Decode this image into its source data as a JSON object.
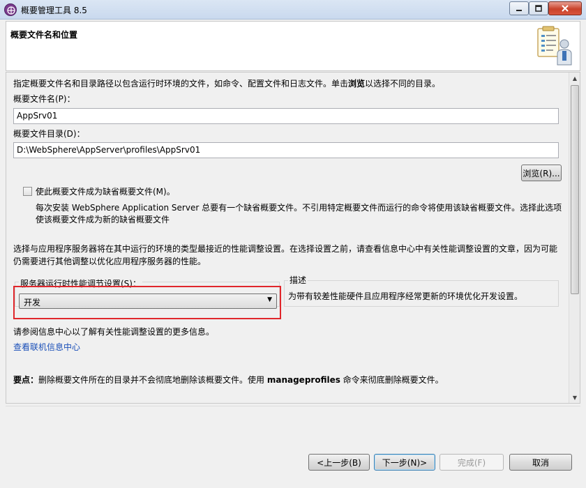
{
  "window": {
    "title": "概要管理工具 8.5",
    "minimize_glyph": "0",
    "maximize_glyph": "1",
    "close_glyph": "r"
  },
  "header": {
    "title": "概要文件名和位置",
    "icon": "clipboard-person-icon"
  },
  "intro_text": "指定概要文件名和目录路径以包含运行时环境的文件，如命令、配置文件和日志文件。单击",
  "intro_bold": "浏览",
  "intro_tail": "以选择不同的目录。",
  "profile_name": {
    "label": "概要文件名(P)：",
    "value": "AppSrv01"
  },
  "profile_dir": {
    "label": "概要文件目录(D)：",
    "value": "D:\\WebSphere\\AppServer\\profiles\\AppSrv01"
  },
  "browse_button": "浏览(R)...",
  "default_profile": {
    "checked": false,
    "label": "使此概要文件成为缺省概要文件(M)。",
    "desc_line1": "每次安装 WebSphere Application Server 总要有一个缺省概要文件。不引用特定概要文件而运行的命令将使用该缺省概要文件。选择此选项",
    "desc_line2": "使该概要文件成为新的缺省概要文件"
  },
  "tuning_intro_line1": "选择与应用程序服务器将在其中运行的环境的类型最接近的性能调整设置。在选择设置之前，请查看信息中心中有关性能调整设置的文章，因为可能",
  "tuning_intro_line2": "仍需要进行其他调整以优化应用程序服务器的性能。",
  "tuning": {
    "label": "服务器运行时性能调节设置(S)：",
    "selected": "开发",
    "highlight_color": "#e0262b"
  },
  "description": {
    "title": "描述",
    "text": "为带有较差性能硬件且应用程序经常更新的环境优化开发设置。"
  },
  "more_info": "请参阅信息中心以了解有关性能调整设置的更多信息。",
  "online_link": "查看联机信息中心",
  "important": {
    "label": "要点：",
    "text_before": "删除概要文件所在的目录并不会彻底地删除该概要文件。使用 ",
    "command": "manageprofiles",
    "text_after": " 命令来彻底删除概要文件。"
  },
  "footer": {
    "back": "<上一步(B)",
    "next": "下一步(N)>",
    "finish": "完成(F)",
    "cancel": "取消"
  }
}
